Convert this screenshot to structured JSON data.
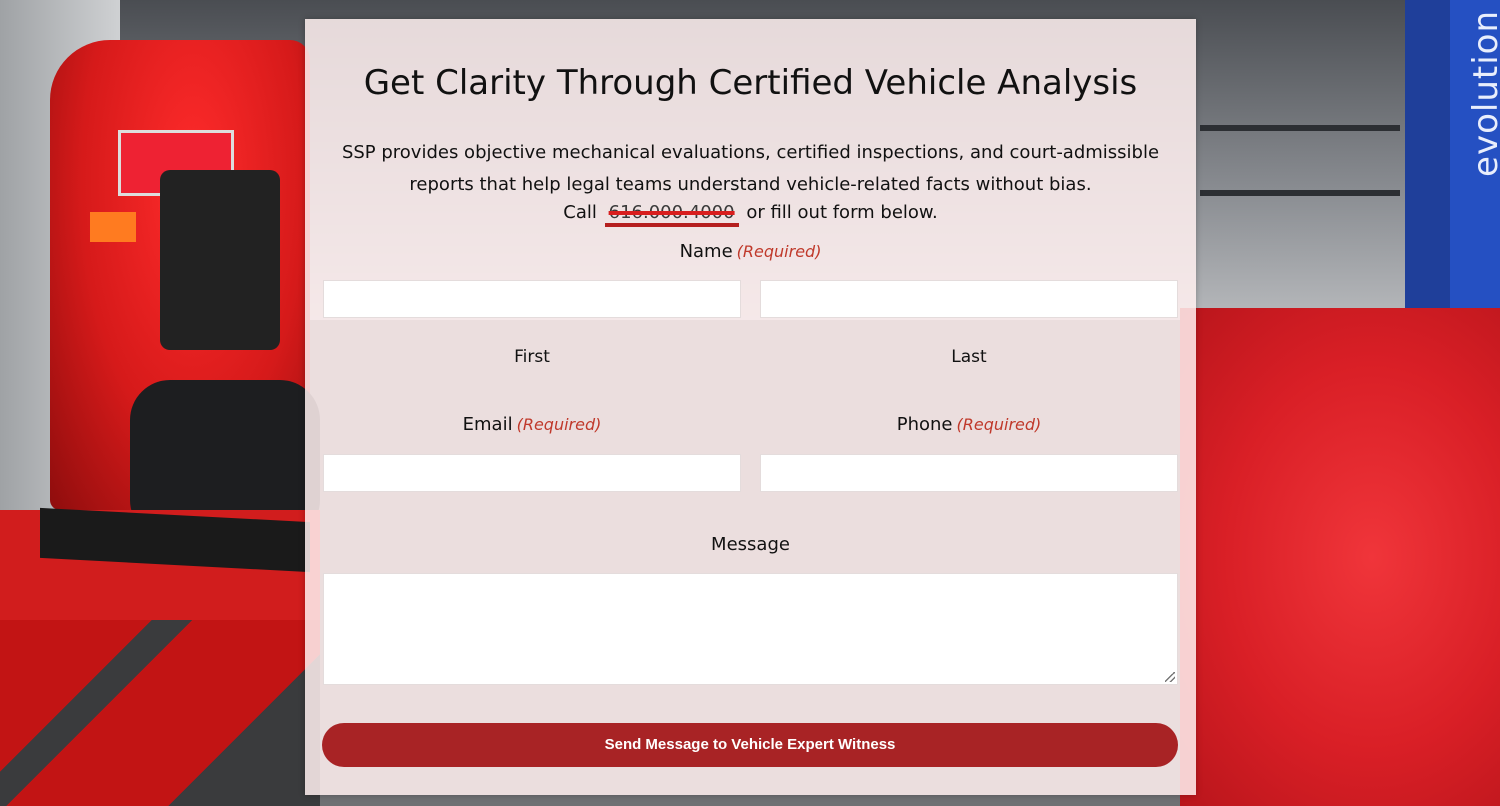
{
  "background": {
    "lift_brand_text": "evolution"
  },
  "form": {
    "title": "Get Clarity Through Certified Vehicle Analysis",
    "intro": "SSP provides objective mechanical evaluations, certified inspections, and court-admissible reports that help legal teams understand vehicle-related facts without bias.",
    "call_prefix": "Call",
    "phone": "616.000.4000",
    "call_suffix": "or fill out form below.",
    "name_label": "Name",
    "required_text": "(Required)",
    "first_label": "First",
    "last_label": "Last",
    "email_label": "Email",
    "phone_label": "Phone",
    "message_label": "Message",
    "first_value": "",
    "last_value": "",
    "email_value": "",
    "phone_value": "",
    "message_value": "",
    "submit_label": "Send Message to Vehicle Expert Witness"
  },
  "colors": {
    "accent": "#a82325",
    "required": "#c0392b",
    "panel": "#fff0f0"
  }
}
